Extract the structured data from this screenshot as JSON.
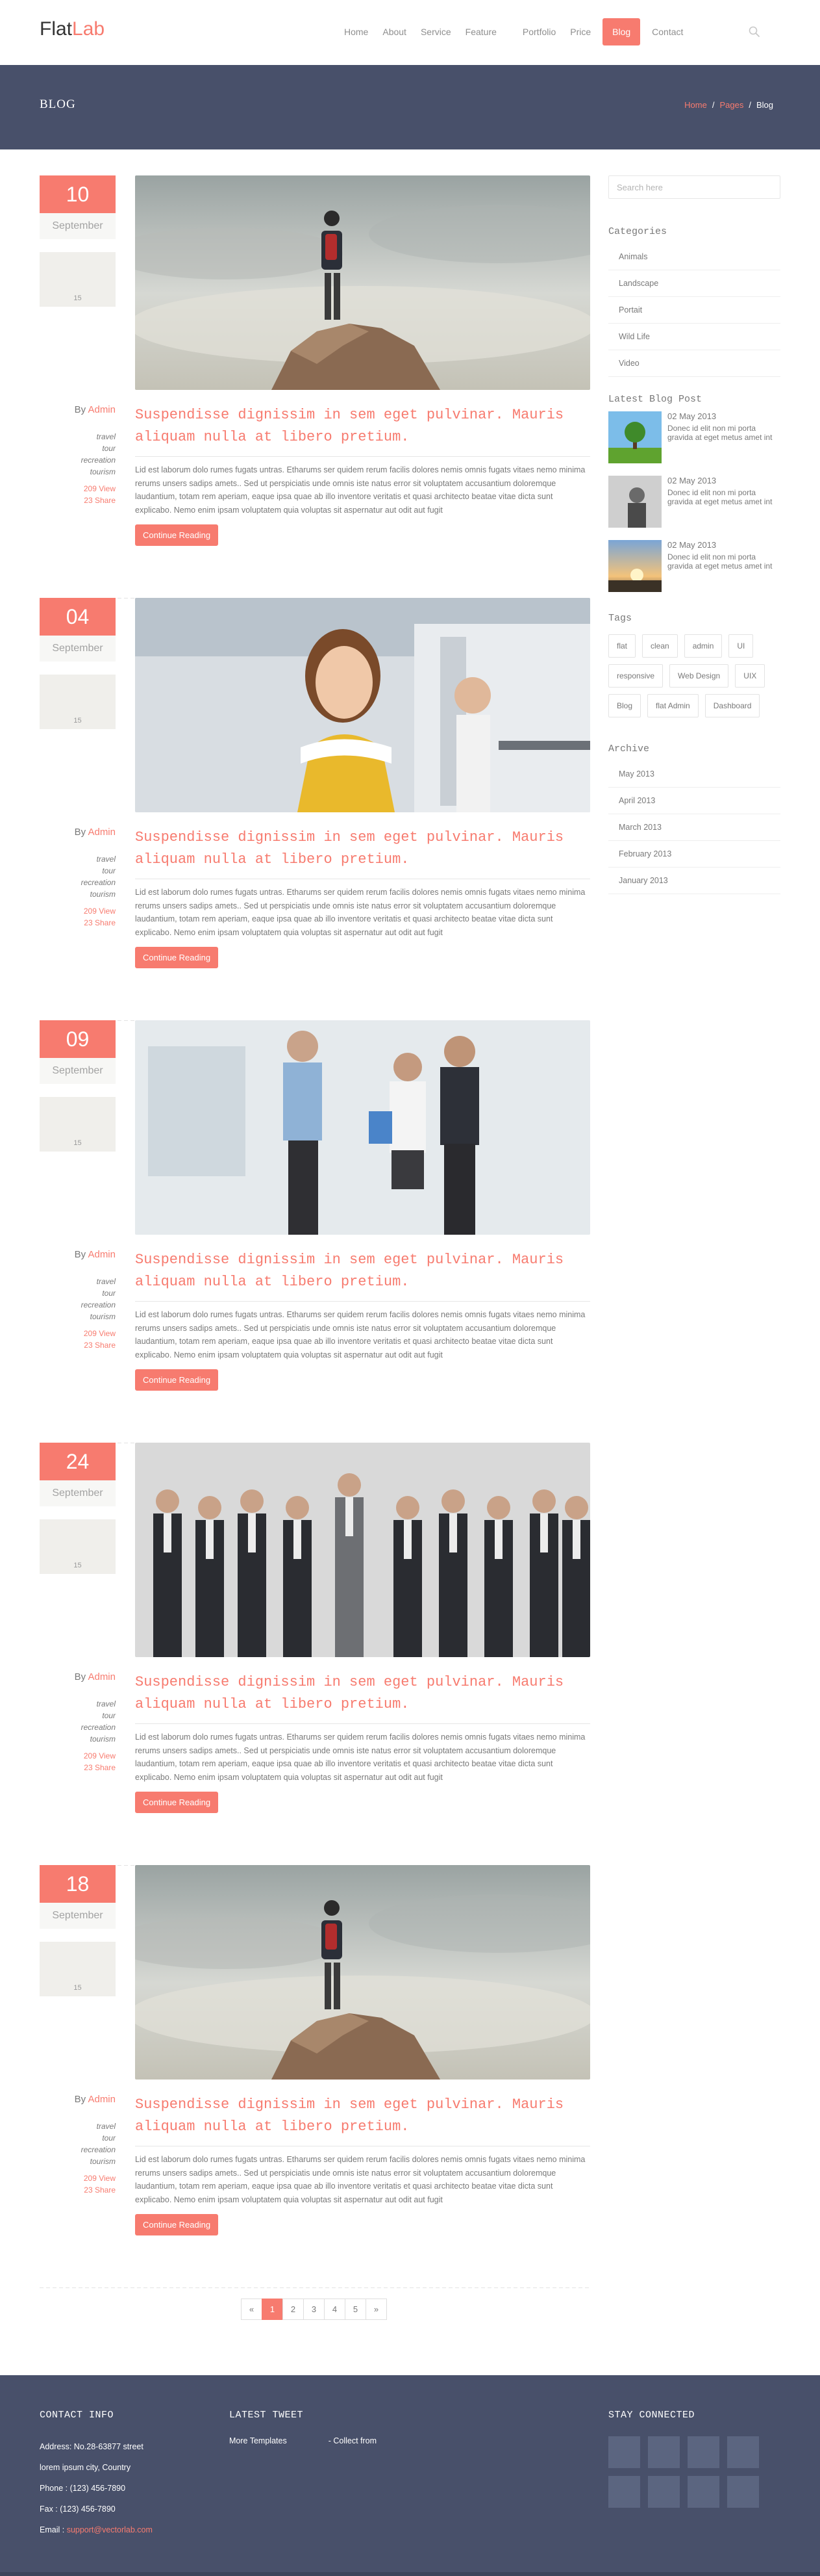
{
  "brand": {
    "logo_main": "Flat",
    "logo_accent": "Lab"
  },
  "nav": [
    {
      "label": "Home",
      "active": false
    },
    {
      "label": "About",
      "active": false
    },
    {
      "label": "Service",
      "active": false
    },
    {
      "label": "Feature",
      "active": false
    },
    {
      "label": "Portfolio",
      "active": false
    },
    {
      "label": "Price",
      "active": false
    },
    {
      "label": "Blog",
      "active": true
    },
    {
      "label": "Contact",
      "active": false
    }
  ],
  "page": {
    "title": "BLOG",
    "breadcrumb": [
      "Home",
      "Pages",
      "Blog"
    ],
    "breadcrumb_separator": "/"
  },
  "posts": [
    {
      "day": "10",
      "month": "September",
      "comments": "15",
      "author_prefix": "By",
      "author": "Admin",
      "tags": [
        "travel",
        "tour",
        "recreation",
        "tourism"
      ],
      "views": "209 View",
      "shares": "23 Share",
      "title": "Suspendisse dignissim in sem eget pulvinar. Mauris aliquam nulla at libero pretium.",
      "text": "Lid est laborum dolo rumes fugats untras. Etharums ser quidem rerum facilis dolores nemis omnis fugats vitaes nemo minima rerums unsers sadips amets.. Sed ut perspiciatis unde omnis iste natus error sit voluptatem accusantium doloremque laudantium, totam rem aperiam, eaque ipsa quae ab illo inventore veritatis et quasi architecto beatae vitae dicta sunt explicabo. Nemo enim ipsam voluptatem quia voluptas sit aspernatur aut odit aut fugit",
      "button": "Continue Reading",
      "image": "mountain"
    },
    {
      "day": "04",
      "month": "September",
      "comments": "15",
      "author_prefix": "By",
      "author": "Admin",
      "tags": [
        "travel",
        "tour",
        "recreation",
        "tourism"
      ],
      "views": "209 View",
      "shares": "23 Share",
      "title": "Suspendisse dignissim in sem eget pulvinar. Mauris aliquam nulla at libero pretium.",
      "text": "Lid est laborum dolo rumes fugats untras. Etharums ser quidem rerum facilis dolores nemis omnis fugats vitaes nemo minima rerums unsers sadips amets.. Sed ut perspiciatis unde omnis iste natus error sit voluptatem accusantium doloremque laudantium, totam rem aperiam, eaque ipsa quae ab illo inventore veritatis et quasi architecto beatae vitae dicta sunt explicabo. Nemo enim ipsam voluptatem quia voluptas sit aspernatur aut odit aut fugit",
      "button": "Continue Reading",
      "image": "gym"
    },
    {
      "day": "09",
      "month": "September",
      "comments": "15",
      "author_prefix": "By",
      "author": "Admin",
      "tags": [
        "travel",
        "tour",
        "recreation",
        "tourism"
      ],
      "views": "209 View",
      "shares": "23 Share",
      "title": "Suspendisse dignissim in sem eget pulvinar. Mauris aliquam nulla at libero pretium.",
      "text": "Lid est laborum dolo rumes fugats untras. Etharums ser quidem rerum facilis dolores nemis omnis fugats vitaes nemo minima rerums unsers sadips amets.. Sed ut perspiciatis unde omnis iste natus error sit voluptatem accusantium doloremque laudantium, totam rem aperiam, eaque ipsa quae ab illo inventore veritatis et quasi architecto beatae vitae dicta sunt explicabo. Nemo enim ipsam voluptatem quia voluptas sit aspernatur aut odit aut fugit",
      "button": "Continue Reading",
      "image": "office"
    },
    {
      "day": "24",
      "month": "September",
      "comments": "15",
      "author_prefix": "By",
      "author": "Admin",
      "tags": [
        "travel",
        "tour",
        "recreation",
        "tourism"
      ],
      "views": "209 View",
      "shares": "23 Share",
      "title": "Suspendisse dignissim in sem eget pulvinar. Mauris aliquam nulla at libero pretium.",
      "text": "Lid est laborum dolo rumes fugats untras. Etharums ser quidem rerum facilis dolores nemis omnis fugats vitaes nemo minima rerums unsers sadips amets.. Sed ut perspiciatis unde omnis iste natus error sit voluptatem accusantium doloremque laudantium, totam rem aperiam, eaque ipsa quae ab illo inventore veritatis et quasi architecto beatae vitae dicta sunt explicabo. Nemo enim ipsam voluptatem quia voluptas sit aspernatur aut odit aut fugit",
      "button": "Continue Reading",
      "image": "team"
    },
    {
      "day": "18",
      "month": "September",
      "comments": "15",
      "author_prefix": "By",
      "author": "Admin",
      "tags": [
        "travel",
        "tour",
        "recreation",
        "tourism"
      ],
      "views": "209 View",
      "shares": "23 Share",
      "title": "Suspendisse dignissim in sem eget pulvinar. Mauris aliquam nulla at libero pretium.",
      "text": "Lid est laborum dolo rumes fugats untras. Etharums ser quidem rerum facilis dolores nemis omnis fugats vitaes nemo minima rerums unsers sadips amets.. Sed ut perspiciatis unde omnis iste natus error sit voluptatem accusantium doloremque laudantium, totam rem aperiam, eaque ipsa quae ab illo inventore veritatis et quasi architecto beatae vitae dicta sunt explicabo. Nemo enim ipsam voluptatem quia voluptas sit aspernatur aut odit aut fugit",
      "button": "Continue Reading",
      "image": "mountain"
    }
  ],
  "sidebar": {
    "search_placeholder": "Search here",
    "categories_title": "Categories",
    "categories": [
      "Animals",
      "Landscape",
      "Portait",
      "Wild Life",
      "Video"
    ],
    "latest_title": "Latest Blog Post",
    "latest": [
      {
        "date": "02 May 2013",
        "text": "Donec id elit non mi porta gravida at eget metus amet int",
        "thumb": "tree"
      },
      {
        "date": "02 May 2013",
        "text": "Donec id elit non mi porta gravida at eget metus amet int",
        "thumb": "bw"
      },
      {
        "date": "02 May 2013",
        "text": "Donec id elit non mi porta gravida at eget metus amet int",
        "thumb": "sunset"
      }
    ],
    "tags_title": "Tags",
    "tags": [
      "flat",
      "clean",
      "admin",
      "UI",
      "responsive",
      "Web Design",
      "UIX",
      "Blog",
      "flat Admin",
      "Dashboard"
    ],
    "archive_title": "Archive",
    "archive": [
      "May 2013",
      "April 2013",
      "March 2013",
      "February 2013",
      "January 2013"
    ]
  },
  "pagination": {
    "prev": "«",
    "pages": [
      "1",
      "2",
      "3",
      "4",
      "5"
    ],
    "active": "1",
    "next": "»"
  },
  "footer": {
    "contact_title": "CONTACT INFO",
    "contact_lines": [
      "Address: No.28-63877 street",
      "lorem ipsum city, Country",
      "Phone : (123) 456-7890",
      "Fax : (123) 456-7890"
    ],
    "email_prefix": "Email : ",
    "email": "support@vectorlab.com",
    "tweet_title": "LATEST TWEET",
    "tweet_link": "More Templates",
    "tweet_sep": "- Collect from",
    "social_title": "STAY CONNECTED"
  },
  "colors": {
    "accent": "#f77b6f",
    "dark_band": "#48506a",
    "text": "#797979"
  }
}
